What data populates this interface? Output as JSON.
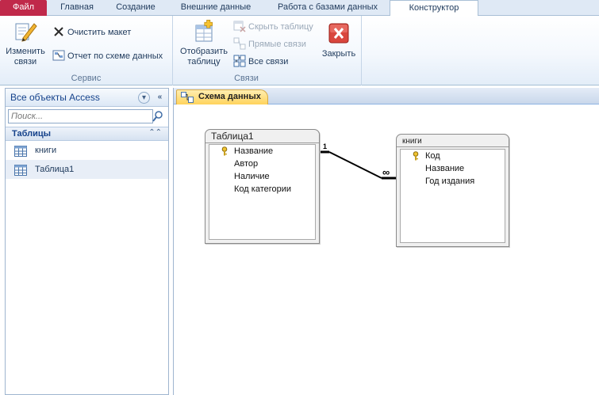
{
  "ribbon_tabs": [
    {
      "label": "Файл"
    },
    {
      "label": "Главная"
    },
    {
      "label": "Создание"
    },
    {
      "label": "Внешние данные"
    },
    {
      "label": "Работа с базами данных"
    },
    {
      "label": "Конструктор"
    }
  ],
  "ribbon": {
    "service_group": {
      "label": "Сервис",
      "edit_relations": "Изменить связи",
      "clear_layout": "Очистить макет",
      "relation_report": "Отчет по схеме данных"
    },
    "relations_group": {
      "label": "Связи",
      "show_table": "Отобразить таблицу",
      "hide_table": "Скрыть таблицу",
      "direct_relations": "Прямые связи",
      "all_relations": "Все связи"
    },
    "close_label": "Закрыть"
  },
  "nav": {
    "title": "Все объекты Access",
    "search_placeholder": "Поиск...",
    "group_label": "Таблицы",
    "items": [
      {
        "label": "книги"
      },
      {
        "label": "Таблица1"
      }
    ]
  },
  "document": {
    "tab_label": "Схема данных",
    "tables": [
      {
        "title": "Таблица1",
        "fields": [
          {
            "name": "Название",
            "key": true
          },
          {
            "name": "Автор",
            "key": false
          },
          {
            "name": "Наличие",
            "key": false
          },
          {
            "name": "Код категории",
            "key": false
          }
        ]
      },
      {
        "title": "книги",
        "fields": [
          {
            "name": "Код",
            "key": true
          },
          {
            "name": "Название",
            "key": false
          },
          {
            "name": "Год издания",
            "key": false
          }
        ]
      }
    ],
    "relation": {
      "one_side": "1",
      "many_side": "∞"
    }
  },
  "colors": {
    "file_tab": "#c0294a",
    "active_doc_tab": "#ffd35c",
    "ribbon_text": "#1e395b"
  }
}
